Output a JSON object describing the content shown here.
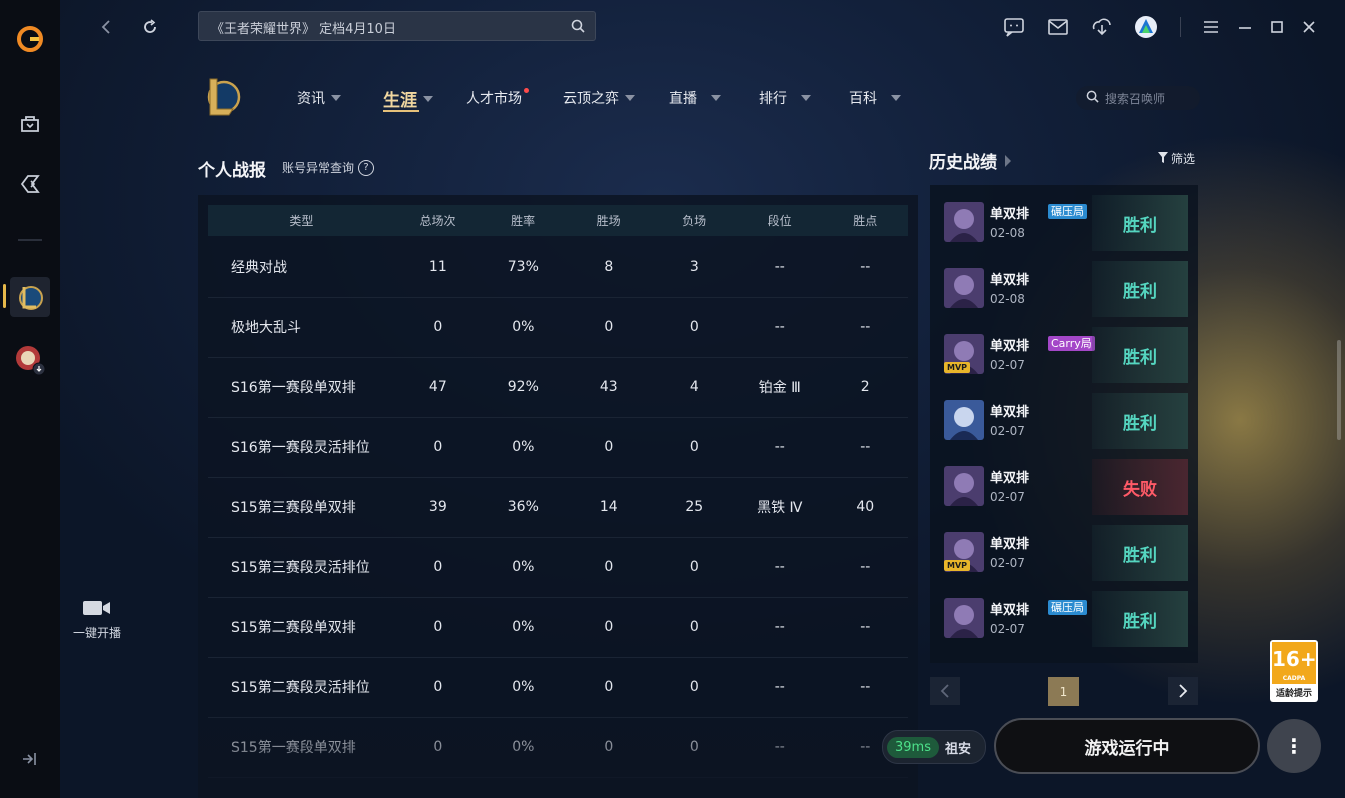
{
  "topbar": {
    "search_text": "《王者荣耀世界》 定档4月10日"
  },
  "sidebar": {
    "live_label": "一键开播"
  },
  "game_nav": {
    "items": [
      {
        "label": "资讯"
      },
      {
        "label": "生涯"
      },
      {
        "label": "人才市场"
      },
      {
        "label": "云顶之弈"
      },
      {
        "label": "直播"
      },
      {
        "label": "排行"
      },
      {
        "label": "百科"
      }
    ],
    "active": "生涯",
    "summoner_search_placeholder": "搜索召唤师"
  },
  "stats": {
    "title": "个人战报",
    "sub_link": "账号异常查询",
    "help": "?",
    "columns": [
      "类型",
      "总场次",
      "胜率",
      "胜场",
      "负场",
      "段位",
      "胜点"
    ],
    "rows": [
      [
        "经典对战",
        "11",
        "73%",
        "8",
        "3",
        "--",
        "--"
      ],
      [
        "极地大乱斗",
        "0",
        "0%",
        "0",
        "0",
        "--",
        "--"
      ],
      [
        "S16第一赛段单双排",
        "47",
        "92%",
        "43",
        "4",
        "铂金 Ⅲ",
        "2"
      ],
      [
        "S16第一赛段灵活排位",
        "0",
        "0%",
        "0",
        "0",
        "--",
        "--"
      ],
      [
        "S15第三赛段单双排",
        "39",
        "36%",
        "14",
        "25",
        "黑铁 Ⅳ",
        "40"
      ],
      [
        "S15第三赛段灵活排位",
        "0",
        "0%",
        "0",
        "0",
        "--",
        "--"
      ],
      [
        "S15第二赛段单双排",
        "0",
        "0%",
        "0",
        "0",
        "--",
        "--"
      ],
      [
        "S15第二赛段灵活排位",
        "0",
        "0%",
        "0",
        "0",
        "--",
        "--"
      ],
      [
        "S15第一赛段单双排",
        "0",
        "0%",
        "0",
        "0",
        "--",
        "--"
      ]
    ]
  },
  "history": {
    "title": "历史战绩",
    "filter_label": "筛选",
    "matches": [
      {
        "mode": "单双排",
        "tag": "碾压局",
        "tag_color": "#2b8bd0",
        "date": "02-08",
        "mvp": false,
        "result": "胜利",
        "win": true
      },
      {
        "mode": "单双排",
        "tag": "",
        "tag_color": "",
        "date": "02-08",
        "mvp": false,
        "result": "胜利",
        "win": true
      },
      {
        "mode": "单双排",
        "tag": "Carry局",
        "tag_color": "#a447c8",
        "date": "02-07",
        "mvp": true,
        "result": "胜利",
        "win": true
      },
      {
        "mode": "单双排",
        "tag": "",
        "tag_color": "",
        "date": "02-07",
        "mvp": false,
        "result": "胜利",
        "win": true
      },
      {
        "mode": "单双排",
        "tag": "",
        "tag_color": "",
        "date": "02-07",
        "mvp": false,
        "result": "失败",
        "win": false
      },
      {
        "mode": "单双排",
        "tag": "",
        "tag_color": "",
        "date": "02-07",
        "mvp": true,
        "result": "胜利",
        "win": true
      },
      {
        "mode": "单双排",
        "tag": "碾压局",
        "tag_color": "#2b8bd0",
        "date": "02-07",
        "mvp": false,
        "result": "胜利",
        "win": true
      }
    ],
    "mvp_label": "MVP",
    "current_page": "1"
  },
  "footer": {
    "ping": "39ms",
    "server": "祖安",
    "launch_label": "游戏运行中",
    "more": "⋮",
    "age_rating": "16+",
    "age_org": "CADPA",
    "age_hint": "适龄提示"
  }
}
